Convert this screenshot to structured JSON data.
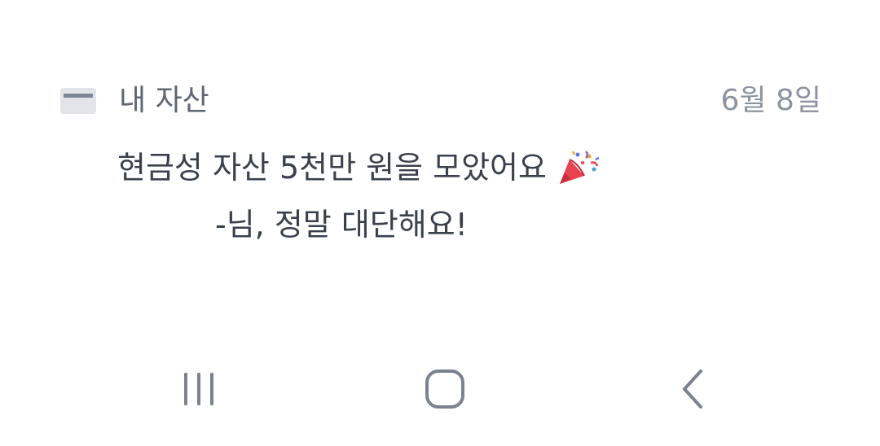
{
  "notification": {
    "app_icon": "card-icon",
    "app_name": "내 자산",
    "date": "6월 8일",
    "title": "현금성 자산 5천만 원을 모았어요",
    "title_emoji": "party-popper-icon",
    "body_suffix": "님, 정말 대단해요!",
    "body_prefix_partial": "-"
  },
  "nav": {
    "recent_icon": "recent-apps-icon",
    "home_icon": "home-icon",
    "back_icon": "back-icon"
  },
  "colors": {
    "app_name": "#5e6672",
    "date": "#8b93a0",
    "text": "#3a414c",
    "nav_icon": "#7a8290",
    "icon_bg": "#e1e4e9",
    "icon_stripe": "#7d8694"
  }
}
